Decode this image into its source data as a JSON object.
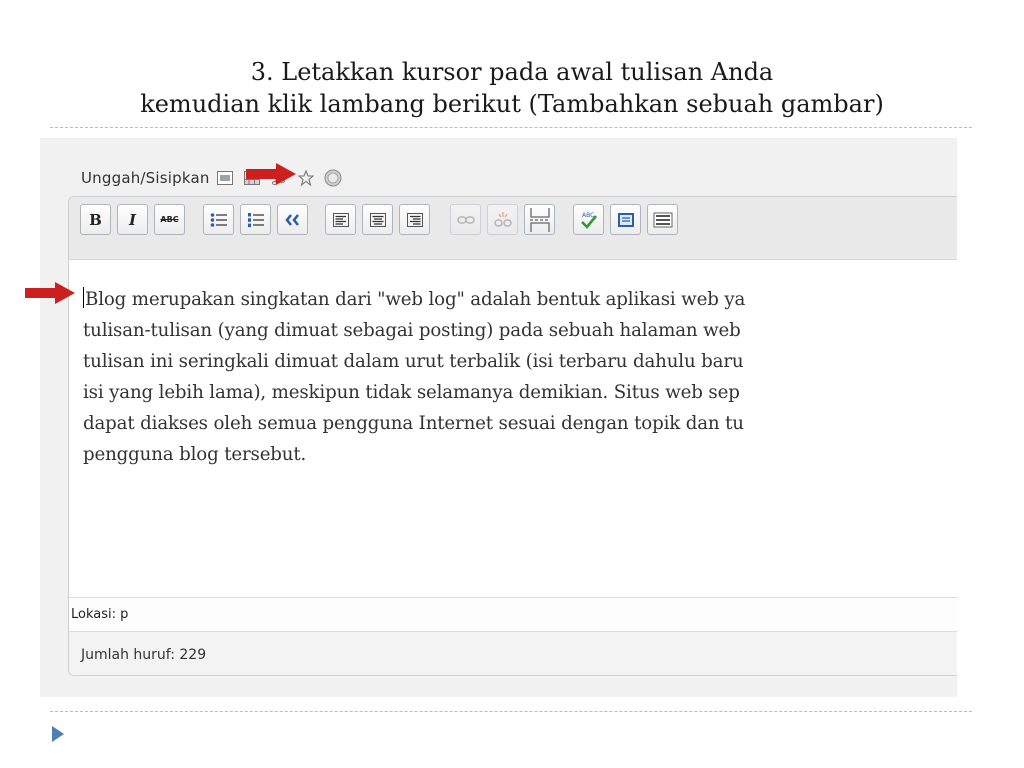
{
  "slide": {
    "title_line1": "3. Letakkan kursor pada awal tulisan Anda",
    "title_line2": "kemudian klik lambang berikut (Tambahkan sebuah gambar)"
  },
  "upload": {
    "label": "Unggah/Sisipkan",
    "icons": [
      "add-image-icon",
      "add-video-icon",
      "add-audio-icon",
      "add-media-icon",
      "add-poll-icon"
    ]
  },
  "toolbar": {
    "bold_label": "B",
    "italic_label": "I",
    "strike_label": "ABC",
    "icons": [
      "bold-icon",
      "italic-icon",
      "strikethrough-icon",
      "bulleted-list-icon",
      "numbered-list-icon",
      "blockquote-icon",
      "align-left-icon",
      "align-center-icon",
      "align-right-icon",
      "insert-link-icon",
      "remove-link-icon",
      "insert-more-tag-icon",
      "spellcheck-icon",
      "fullscreen-icon",
      "kitchen-sink-icon"
    ]
  },
  "content": {
    "lines": [
      "Blog merupakan singkatan dari \"web log\" adalah bentuk aplikasi web ya",
      "tulisan-tulisan (yang dimuat sebagai posting) pada sebuah halaman web",
      "tulisan ini seringkali dimuat dalam urut terbalik (isi terbaru dahulu baru",
      "isi yang lebih lama), meskipun tidak selamanya demikian. Situs web sep",
      "dapat diakses oleh semua pengguna Internet sesuai dengan topik dan tu",
      "pengguna blog tersebut."
    ]
  },
  "status": {
    "path_label": "Lokasi: p",
    "word_count_label": "Jumlah huruf: 229"
  },
  "colors": {
    "arrow": "#cc1f1f",
    "slide_bullet": "#4e7fb0"
  }
}
